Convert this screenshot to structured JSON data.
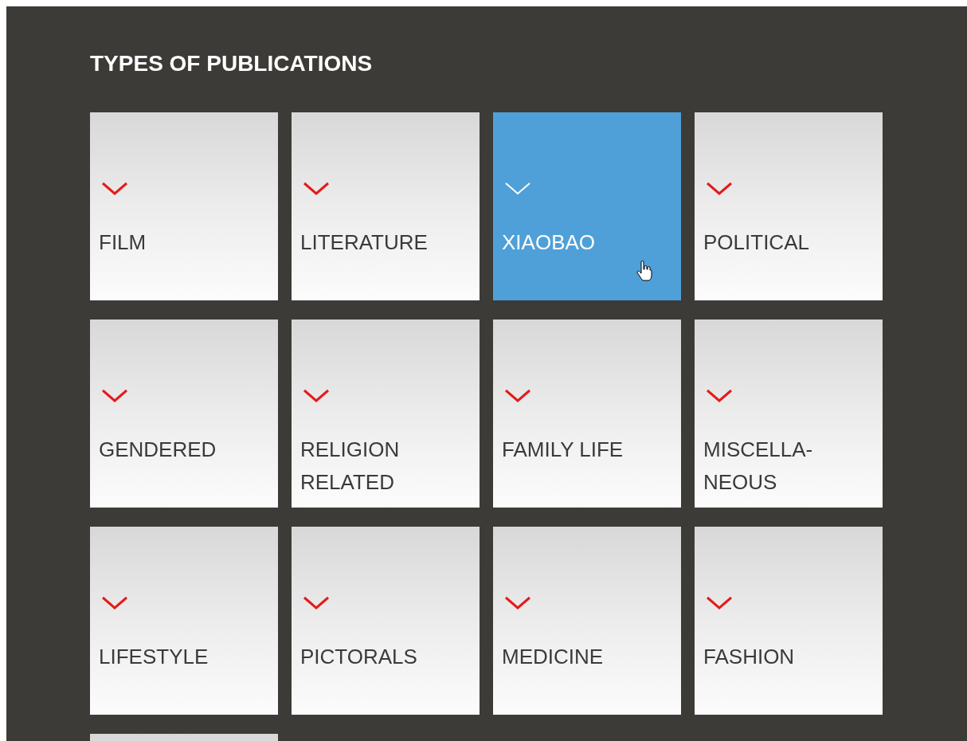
{
  "heading": "TYPES OF PUBLICATIONS",
  "tiles": [
    {
      "label": "FILM",
      "selected": false
    },
    {
      "label": "LITERATURE",
      "selected": false
    },
    {
      "label": "XIAOBAO",
      "selected": true
    },
    {
      "label": "POLITICAL",
      "selected": false
    },
    {
      "label": "GENDERED",
      "selected": false
    },
    {
      "label": "RELIGION RELATED",
      "selected": false
    },
    {
      "label": "FAMILY LIFE",
      "selected": false
    },
    {
      "label": "MISCELLA-\nNEOUS",
      "selected": false
    },
    {
      "label": "LIFESTYLE",
      "selected": false
    },
    {
      "label": "PICTORALS",
      "selected": false
    },
    {
      "label": "MEDICINE",
      "selected": false
    },
    {
      "label": "FASHION",
      "selected": false
    },
    {
      "selected": false
    }
  ]
}
